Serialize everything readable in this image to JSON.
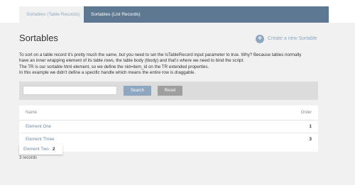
{
  "tabs": [
    {
      "label": "Sortables (Table Records)",
      "active": true
    },
    {
      "label": "Sortables (List Records)",
      "active": false
    }
  ],
  "header": {
    "title": "Sortables",
    "create_label": "Create a new Sortable"
  },
  "description": [
    "To sort on a table record it's pretty much the same, but you need to set the IsTableRecord input parameter to true. Why? Because tables normally",
    "have an inner wrapping element of its table rows, the table body (tbody) and that's where we need to bind the script.",
    "The TR is our sortable html element, so we define the nid=item_id on the TR extended properties.",
    "In this example we didn't define a specific handle which means the entire row is draggable."
  ],
  "search": {
    "value": "",
    "placeholder": "",
    "search_label": "Search",
    "reset_label": "Reset"
  },
  "table": {
    "columns": [
      "Name",
      "Order"
    ],
    "rows": [
      {
        "name": "Element One",
        "order": "1"
      },
      {
        "name": "Element Three",
        "order": "3"
      }
    ],
    "dragging_row": {
      "name": "Element Two",
      "order": "2"
    }
  },
  "footer": {
    "records": "3 records"
  },
  "colors": {
    "accent": "#8ea6bf",
    "tabbar": "#5f7891",
    "reset": "#9f9f9f"
  }
}
